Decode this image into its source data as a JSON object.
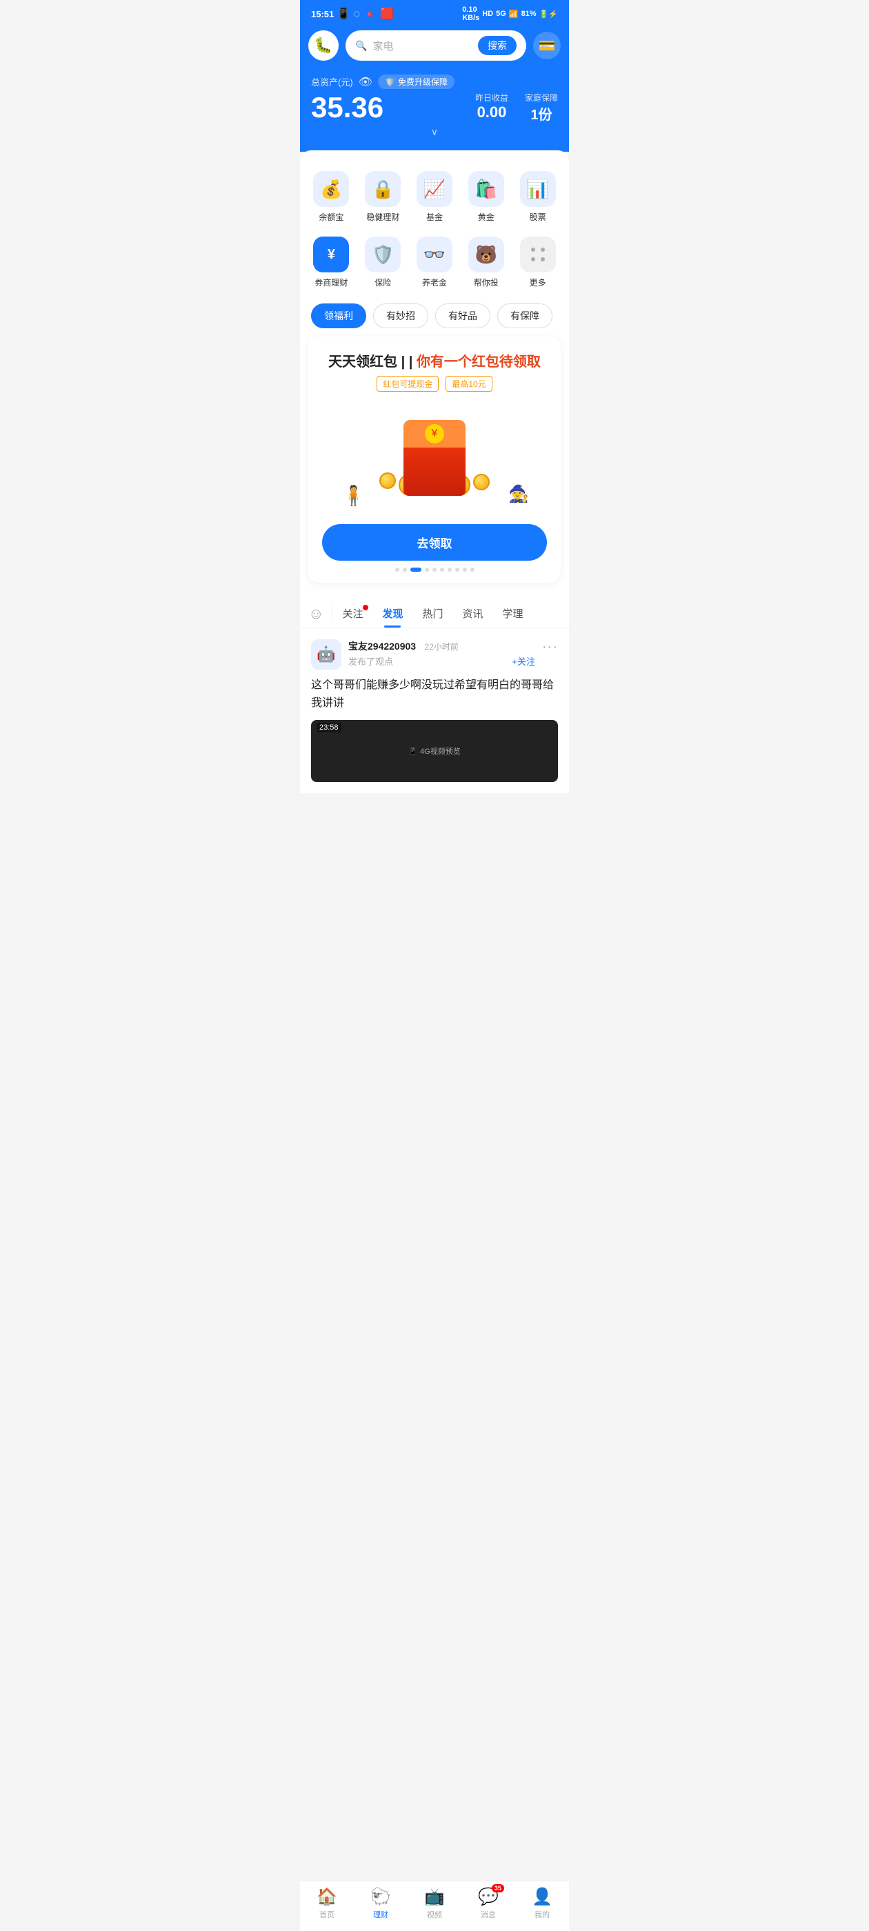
{
  "statusBar": {
    "time": "15:51",
    "battery": "81%",
    "signal": "5G"
  },
  "header": {
    "searchPlaceholder": "家电",
    "searchButton": "搜索"
  },
  "assets": {
    "label": "总资产(元)",
    "shieldLabel": "免费升级保障",
    "mainValue": "35.36",
    "yesterdayLabel": "昨日收益",
    "yesterdayValue": "0.00",
    "familyLabel": "家庭保障",
    "familyValue": "1份"
  },
  "gridItems": [
    {
      "label": "余额宝",
      "icon": "💰"
    },
    {
      "label": "稳健理财",
      "icon": "🔒"
    },
    {
      "label": "基金",
      "icon": "📈"
    },
    {
      "label": "黄金",
      "icon": "🛍️"
    },
    {
      "label": "股票",
      "icon": "📊"
    },
    {
      "label": "券商理财",
      "icon": "¥"
    },
    {
      "label": "保险",
      "icon": "🛡️"
    },
    {
      "label": "养老金",
      "icon": "👓"
    },
    {
      "label": "帮你投",
      "icon": "🐻"
    },
    {
      "label": "更多",
      "icon": "⠿"
    }
  ],
  "tabs": [
    {
      "label": "领福利",
      "active": true
    },
    {
      "label": "有妙招",
      "active": false
    },
    {
      "label": "有好品",
      "active": false
    },
    {
      "label": "有保障",
      "active": false
    }
  ],
  "banner": {
    "title1": "天天领红包 | |",
    "titleRed": " 你有一个红包待领取",
    "badge1": "红包可提现金",
    "badge2": "最高10元",
    "button": "去领取"
  },
  "dotsCount": 10,
  "dotsActive": 3,
  "contentTabs": [
    {
      "label": "关注",
      "active": false,
      "badge": true
    },
    {
      "label": "发现",
      "active": true
    },
    {
      "label": "热门",
      "active": false
    },
    {
      "label": "资讯",
      "active": false
    },
    {
      "label": "学理",
      "active": false
    }
  ],
  "feedItem": {
    "username": "宝友294220903",
    "time": "22小时前",
    "action": "发布了观点",
    "followText": "+关注",
    "content": "这个哥哥们能赚多少啊没玩过希望有明白的哥哥给我讲讲",
    "previewTime": "23:58"
  },
  "bottomNav": [
    {
      "label": "首页",
      "icon": "🏠",
      "active": false
    },
    {
      "label": "理财",
      "icon": "🐑",
      "active": true
    },
    {
      "label": "视频",
      "icon": "📺",
      "active": false
    },
    {
      "label": "消息",
      "icon": "💬",
      "active": false,
      "badge": "35"
    },
    {
      "label": "我的",
      "icon": "👤",
      "active": false
    }
  ]
}
